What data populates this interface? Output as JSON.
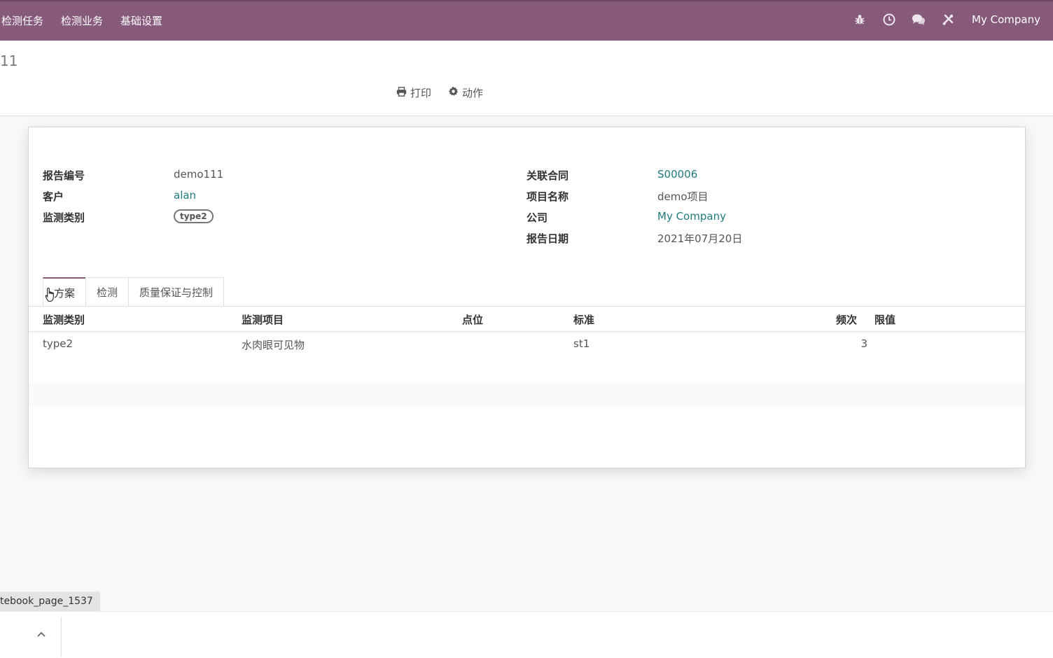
{
  "topbar": {
    "menu": [
      "检测任务",
      "检测业务",
      "基础设置"
    ],
    "icons": [
      "bug-icon",
      "clock-icon",
      "chat-icon",
      "tools-icon"
    ],
    "company": "My Company",
    "bg_color": "#875a7b"
  },
  "control_panel": {
    "title": "11",
    "print_label": "打印",
    "action_label": "动作"
  },
  "form": {
    "left": [
      {
        "label": "报告编号",
        "value": "demo111"
      },
      {
        "label": "客户",
        "value": "alan"
      },
      {
        "label": "监测类别",
        "value": "type2"
      }
    ],
    "right": [
      {
        "label": "关联合同",
        "value": "S00006"
      },
      {
        "label": "项目名称",
        "value": "demo项目"
      },
      {
        "label": "公司",
        "value": "My Company"
      },
      {
        "label": "报告日期",
        "value": "2021年07月20日"
      }
    ]
  },
  "tabs": [
    "方案",
    "检测",
    "质量保证与控制"
  ],
  "table": {
    "headers": [
      "监测类别",
      "监测项目",
      "点位",
      "标准",
      "频次",
      "限值"
    ],
    "rows": [
      [
        "type2",
        "水肉眼可见物",
        "",
        "st1",
        "3",
        ""
      ]
    ]
  },
  "tooltip": "tebook_page_1537",
  "link_color": "#1f7a7f"
}
